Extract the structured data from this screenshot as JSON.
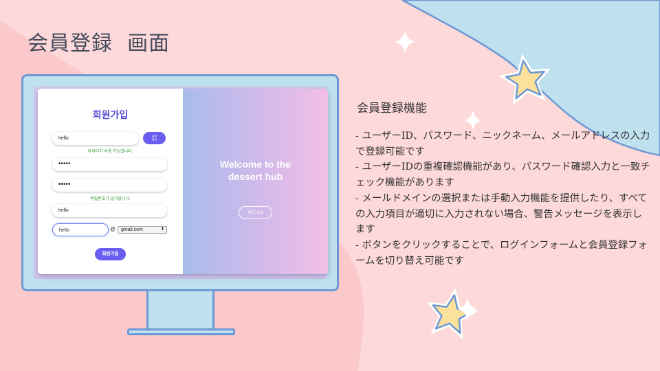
{
  "slide": {
    "title": "会員登録  画面",
    "section_heading": "会員登録機能",
    "features": [
      "-  ユーザーID、パスワード、ニックネーム、メールアドレスの入力で登録可能です",
      "-  ユーザーIDの重複確認機能があり、パスワード確認入力と一致チェック機能があります",
      "-  メールドメインの選択または手動入力機能を提供したり、すべての入力項目が適切に入力されない場合、警告メッセージを表示します",
      "-  ボタンをクリックすることで、ログインフォームと会員登録フォームを切り替え可能です"
    ]
  },
  "signup_form": {
    "title": "회원가입",
    "user_id_value": "hello",
    "duplicate_check_label_line1": "중복",
    "duplicate_check_label_line2": "확인",
    "id_available_message": "아이디가 사용 가능합니다.",
    "password_value": "•••••",
    "password_confirm_value": "•••••",
    "password_match_message": "비밀번호가 일치합니다.",
    "nickname_value": "hello",
    "email_local_value": "hello",
    "at_symbol": "@",
    "email_domain_selected": "gmail.com",
    "submit_label": "회원가입"
  },
  "welcome_panel": {
    "line1": "Welcome to the",
    "line2": "dessert hub",
    "hello_button_label": "HELLO"
  },
  "colors": {
    "background": "#fdd9da",
    "accent_purple": "#6a5ef0",
    "monitor_fill": "#bfe0ee",
    "monitor_border": "#6d98d4",
    "success_green": "#2c9a2c"
  }
}
